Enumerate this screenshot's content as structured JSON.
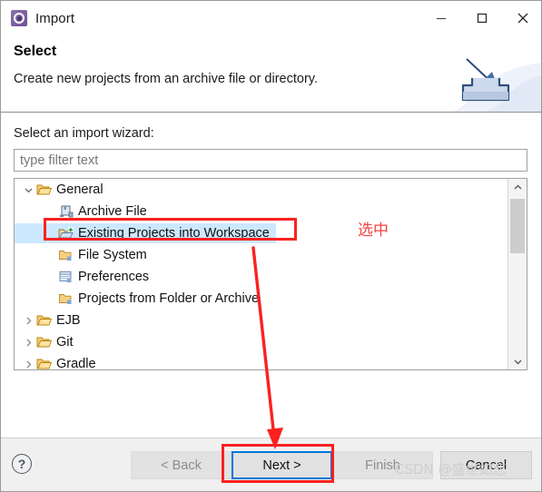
{
  "window": {
    "title": "Import",
    "title_icon": "import-wizard-icon",
    "controls": {
      "minimize": "minimize-icon",
      "maximize": "maximize-icon",
      "close": "close-icon"
    }
  },
  "banner": {
    "title": "Select",
    "description": "Create new projects from an archive file or directory.",
    "art_icon": "import-tray-arrow-icon"
  },
  "main": {
    "wizard_label": "Select an import wizard:",
    "filter": {
      "value": "",
      "placeholder": "type filter text"
    },
    "tree": [
      {
        "label": "General",
        "level": 1,
        "twisty": "expanded",
        "icon": "open-folder-icon",
        "selected": false
      },
      {
        "label": "Archive File",
        "level": 2,
        "twisty": "none",
        "icon": "archive-file-icon",
        "selected": false
      },
      {
        "label": "Existing Projects into Workspace",
        "level": 2,
        "twisty": "none",
        "icon": "import-project-folder-icon",
        "selected": true
      },
      {
        "label": "File System",
        "level": 2,
        "twisty": "none",
        "icon": "folder-icon",
        "selected": false
      },
      {
        "label": "Preferences",
        "level": 2,
        "twisty": "none",
        "icon": "preferences-icon",
        "selected": false
      },
      {
        "label": "Projects from Folder or Archive",
        "level": 2,
        "twisty": "none",
        "icon": "folder-icon",
        "selected": false
      },
      {
        "label": "EJB",
        "level": 1,
        "twisty": "collapsed",
        "icon": "closed-folder-icon",
        "selected": false
      },
      {
        "label": "Git",
        "level": 1,
        "twisty": "collapsed",
        "icon": "closed-folder-icon",
        "selected": false
      },
      {
        "label": "Gradle",
        "level": 1,
        "twisty": "collapsed",
        "icon": "closed-folder-icon",
        "selected": false
      }
    ],
    "scrollbar": {
      "up_icon": "chevron-up-icon",
      "down_icon": "chevron-down-icon"
    }
  },
  "footer": {
    "help_label": "?",
    "back_label": "< Back",
    "next_label": "Next >",
    "finish_label": "Finish",
    "cancel_label": "Cancel"
  },
  "annotations": {
    "selected_note": "选中",
    "watermark": "CSDN @盛世如恋",
    "highlight_color": "#fb2121",
    "focus_color": "#0078d7",
    "selection_color": "#cce8ff"
  }
}
